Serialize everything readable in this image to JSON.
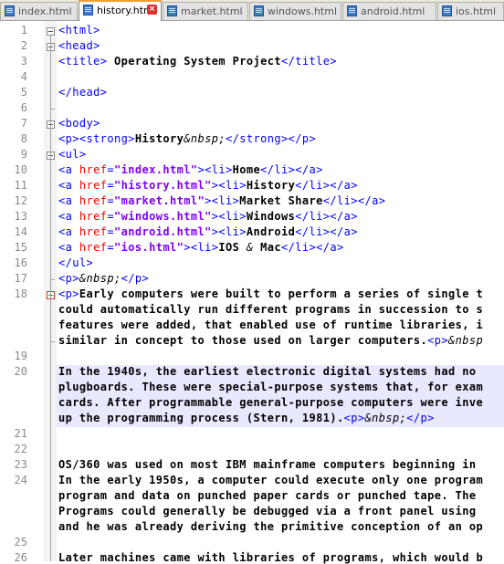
{
  "tabs": [
    {
      "label": "index.html",
      "active": false
    },
    {
      "label": "history.html",
      "active": true
    },
    {
      "label": "market.html",
      "active": false
    },
    {
      "label": "windows.html",
      "active": false
    },
    {
      "label": "android.html",
      "active": false
    },
    {
      "label": "ios.html",
      "active": false
    }
  ],
  "colors": {
    "tag": "#0000ff",
    "attribute": "#ff0000",
    "value": "#8000ff",
    "text": "#000000",
    "highlight": "#e8e8ff"
  },
  "lines": [
    {
      "n": "1",
      "segs": [
        {
          "c": "tag",
          "t": "<html>"
        }
      ]
    },
    {
      "n": "2",
      "segs": [
        {
          "c": "tag",
          "t": "<head>"
        }
      ]
    },
    {
      "n": "3",
      "segs": [
        {
          "c": "tag",
          "t": "<title>"
        },
        {
          "c": "txt",
          "t": " Operating System Project"
        },
        {
          "c": "tag",
          "t": "</title>"
        }
      ]
    },
    {
      "n": "4",
      "segs": []
    },
    {
      "n": "5",
      "segs": [
        {
          "c": "tag",
          "t": "</head>"
        }
      ]
    },
    {
      "n": "6",
      "segs": []
    },
    {
      "n": "7",
      "segs": [
        {
          "c": "tag",
          "t": "<body>"
        }
      ]
    },
    {
      "n": "8",
      "segs": [
        {
          "c": "tag",
          "t": "<p><strong>"
        },
        {
          "c": "txt",
          "t": "History"
        },
        {
          "c": "ent",
          "t": "&nbsp;"
        },
        {
          "c": "tag",
          "t": "</strong></p>"
        }
      ]
    },
    {
      "n": "9",
      "segs": [
        {
          "c": "tag",
          "t": "<ul>"
        }
      ]
    },
    {
      "n": "10",
      "segs": [
        {
          "c": "tag",
          "t": "<a "
        },
        {
          "c": "attr",
          "t": "href"
        },
        {
          "c": "tag",
          "t": "="
        },
        {
          "c": "val",
          "t": "\"index.html\""
        },
        {
          "c": "tag",
          "t": "><li>"
        },
        {
          "c": "txt",
          "t": "Home"
        },
        {
          "c": "tag",
          "t": "</li></a>"
        }
      ]
    },
    {
      "n": "11",
      "segs": [
        {
          "c": "tag",
          "t": "<a "
        },
        {
          "c": "attr",
          "t": "href"
        },
        {
          "c": "tag",
          "t": "="
        },
        {
          "c": "val",
          "t": "\"history.html\""
        },
        {
          "c": "tag",
          "t": "><li>"
        },
        {
          "c": "txt",
          "t": "History"
        },
        {
          "c": "tag",
          "t": "</li></a>"
        }
      ]
    },
    {
      "n": "12",
      "segs": [
        {
          "c": "tag",
          "t": "<a "
        },
        {
          "c": "attr",
          "t": "href"
        },
        {
          "c": "tag",
          "t": "="
        },
        {
          "c": "val",
          "t": "\"market.html\""
        },
        {
          "c": "tag",
          "t": "><li>"
        },
        {
          "c": "txt",
          "t": "Market Share"
        },
        {
          "c": "tag",
          "t": "</li></a>"
        }
      ]
    },
    {
      "n": "13",
      "segs": [
        {
          "c": "tag",
          "t": "<a "
        },
        {
          "c": "attr",
          "t": "href"
        },
        {
          "c": "tag",
          "t": "="
        },
        {
          "c": "val",
          "t": "\"windows.html\""
        },
        {
          "c": "tag",
          "t": "><li>"
        },
        {
          "c": "txt",
          "t": "Windows"
        },
        {
          "c": "tag",
          "t": "</li></a>"
        }
      ]
    },
    {
      "n": "14",
      "segs": [
        {
          "c": "tag",
          "t": "<a "
        },
        {
          "c": "attr",
          "t": "href"
        },
        {
          "c": "tag",
          "t": "="
        },
        {
          "c": "val",
          "t": "\"android.html\""
        },
        {
          "c": "tag",
          "t": "><li>"
        },
        {
          "c": "txt",
          "t": "Android"
        },
        {
          "c": "tag",
          "t": "</li></a>"
        }
      ]
    },
    {
      "n": "15",
      "segs": [
        {
          "c": "tag",
          "t": "<a "
        },
        {
          "c": "attr",
          "t": "href"
        },
        {
          "c": "tag",
          "t": "="
        },
        {
          "c": "val",
          "t": "\"ios.html\""
        },
        {
          "c": "tag",
          "t": "><li>"
        },
        {
          "c": "txt",
          "t": "IOS "
        },
        {
          "c": "ent",
          "t": "&"
        },
        {
          "c": "txt",
          "t": " Mac"
        },
        {
          "c": "tag",
          "t": "</li></a>"
        }
      ]
    },
    {
      "n": "16",
      "segs": [
        {
          "c": "tag",
          "t": "</ul>"
        }
      ]
    },
    {
      "n": "17",
      "segs": [
        {
          "c": "tag",
          "t": "<p>"
        },
        {
          "c": "ent",
          "t": "&nbsp;"
        },
        {
          "c": "tag",
          "t": "</p>"
        }
      ]
    },
    {
      "n": "18",
      "segs": [
        {
          "c": "tag",
          "t": "<p>"
        },
        {
          "c": "txt",
          "t": "Early computers were built to perform a series of single t"
        }
      ]
    },
    {
      "n": "",
      "segs": [
        {
          "c": "txt",
          "t": "could automatically run different programs in succession to s"
        }
      ]
    },
    {
      "n": "",
      "segs": [
        {
          "c": "txt",
          "t": "features were added, that enabled use of runtime libraries, i"
        }
      ]
    },
    {
      "n": "",
      "segs": [
        {
          "c": "txt",
          "t": "similar in concept to those used on larger computers."
        },
        {
          "c": "tag",
          "t": "<p>"
        },
        {
          "c": "ent",
          "t": "&nbsp"
        }
      ]
    },
    {
      "n": "19",
      "segs": []
    },
    {
      "n": "20",
      "segs": [
        {
          "c": "txt",
          "t": "In the 1940s, the earliest electronic digital systems had no"
        }
      ]
    },
    {
      "n": "",
      "segs": [
        {
          "c": "txt",
          "t": "plugboards. These were special-purpose systems that, for exam"
        }
      ]
    },
    {
      "n": "",
      "segs": [
        {
          "c": "txt",
          "t": "cards. After programmable general-purpose computers were inve"
        }
      ]
    },
    {
      "n": "",
      "segs": [
        {
          "c": "txt",
          "t": "up the programming process (Stern, 1981)."
        },
        {
          "c": "tag",
          "t": "<p>"
        },
        {
          "c": "ent",
          "t": "&nbsp;"
        },
        {
          "c": "tag",
          "t": "</p>"
        }
      ]
    },
    {
      "n": "21",
      "segs": []
    },
    {
      "n": "22",
      "segs": []
    },
    {
      "n": "23",
      "segs": [
        {
          "c": "txt",
          "t": "OS/360 was used on most IBM mainframe computers beginning in"
        }
      ]
    },
    {
      "n": "24",
      "segs": [
        {
          "c": "txt",
          "t": "In the early 1950s, a computer could execute only one program"
        }
      ]
    },
    {
      "n": "",
      "segs": [
        {
          "c": "txt",
          "t": "program and data on punched paper cards or punched tape. The"
        }
      ]
    },
    {
      "n": "",
      "segs": [
        {
          "c": "txt",
          "t": "Programs could generally be debugged via a front panel using"
        }
      ]
    },
    {
      "n": "",
      "segs": [
        {
          "c": "txt",
          "t": "and he was already deriving the primitive conception of an op"
        }
      ]
    },
    {
      "n": "25",
      "segs": []
    },
    {
      "n": "26",
      "segs": [
        {
          "c": "txt",
          "t": "Later machines came with libraries of programs, which would b"
        }
      ]
    }
  ]
}
